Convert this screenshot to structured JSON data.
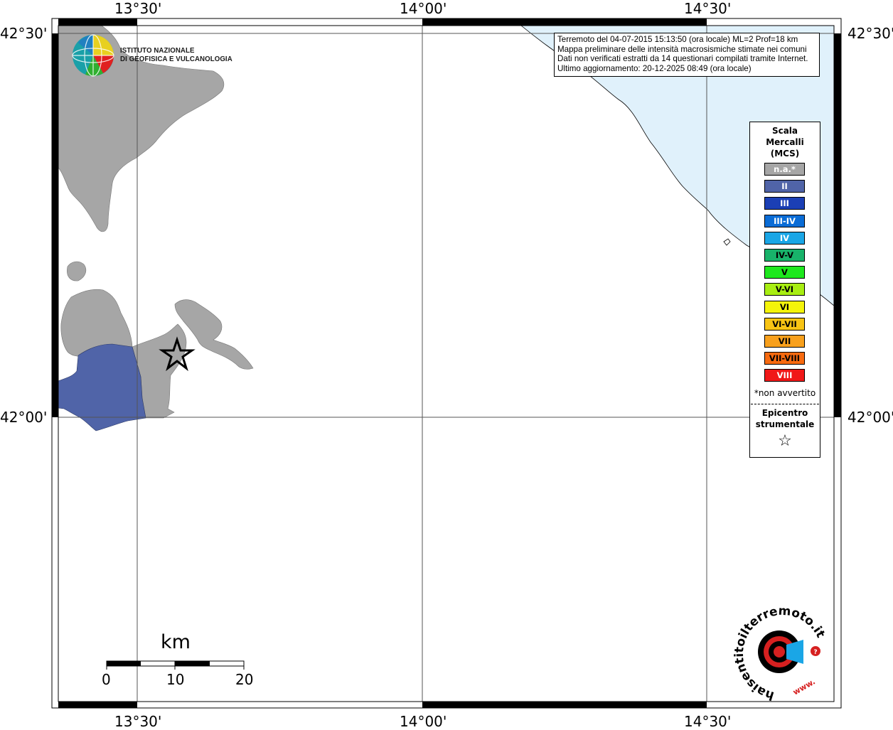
{
  "map": {
    "lon_labels": [
      "13°30'",
      "14°00'",
      "14°30'"
    ],
    "lat_labels": [
      "42°30'",
      "42°00'"
    ]
  },
  "info": {
    "line1": "Terremoto del 04-07-2015 15:13:50 (ora locale) ML=2 Prof=18 km",
    "line2": "Mappa preliminare delle intensità macrosismiche stimate nei comuni",
    "line3": "Dati non verificati estratti da 14 questionari compilati tramite Internet.",
    "line4": "Ultimo aggiornamento: 20-12-2025 08:49 (ora locale)"
  },
  "logo": {
    "institute_line1": "ISTITUTO NAZIONALE",
    "institute_line2": "DI GEOFISICA E VULCANOLOGIA",
    "haisentito_text": "haisentitoilterremoto.it",
    "haisentito_www": "www."
  },
  "legend": {
    "title_line1": "Scala",
    "title_line2": "Mercalli",
    "title_line3": "(MCS)",
    "items": [
      {
        "label": "n.a.*",
        "color": "#a6a6a6",
        "text_color": "#ffffff"
      },
      {
        "label": "II",
        "color": "#5064a8",
        "text_color": "#ffffff"
      },
      {
        "label": "III",
        "color": "#1b3fb5",
        "text_color": "#ffffff"
      },
      {
        "label": "III-IV",
        "color": "#0a6cd6",
        "text_color": "#ffffff"
      },
      {
        "label": "IV",
        "color": "#1aa6e6",
        "text_color": "#ffffff"
      },
      {
        "label": "IV-V",
        "color": "#18b36a",
        "text_color": "#000000"
      },
      {
        "label": "V",
        "color": "#1ee81e",
        "text_color": "#000000"
      },
      {
        "label": "V-VI",
        "color": "#a8ee12",
        "text_color": "#000000"
      },
      {
        "label": "VI",
        "color": "#f4f40a",
        "text_color": "#000000"
      },
      {
        "label": "VI-VII",
        "color": "#f8c414",
        "text_color": "#000000"
      },
      {
        "label": "VII",
        "color": "#f8a01c",
        "text_color": "#000000"
      },
      {
        "label": "VII-VIII",
        "color": "#f76a10",
        "text_color": "#000000"
      },
      {
        "label": "VIII",
        "color": "#f01818",
        "text_color": "#ffffff"
      }
    ],
    "note": "*non avvertito",
    "epicenter_line1": "Epicentro",
    "epicenter_line2": "strumentale",
    "epicenter_symbol": "☆"
  },
  "scale": {
    "title": "km",
    "labels": [
      "0",
      "10",
      "20"
    ]
  },
  "colors": {
    "sea": "#e0f1fb",
    "land_na": "#a6a6a6",
    "intensity_II": "#5064a8"
  }
}
